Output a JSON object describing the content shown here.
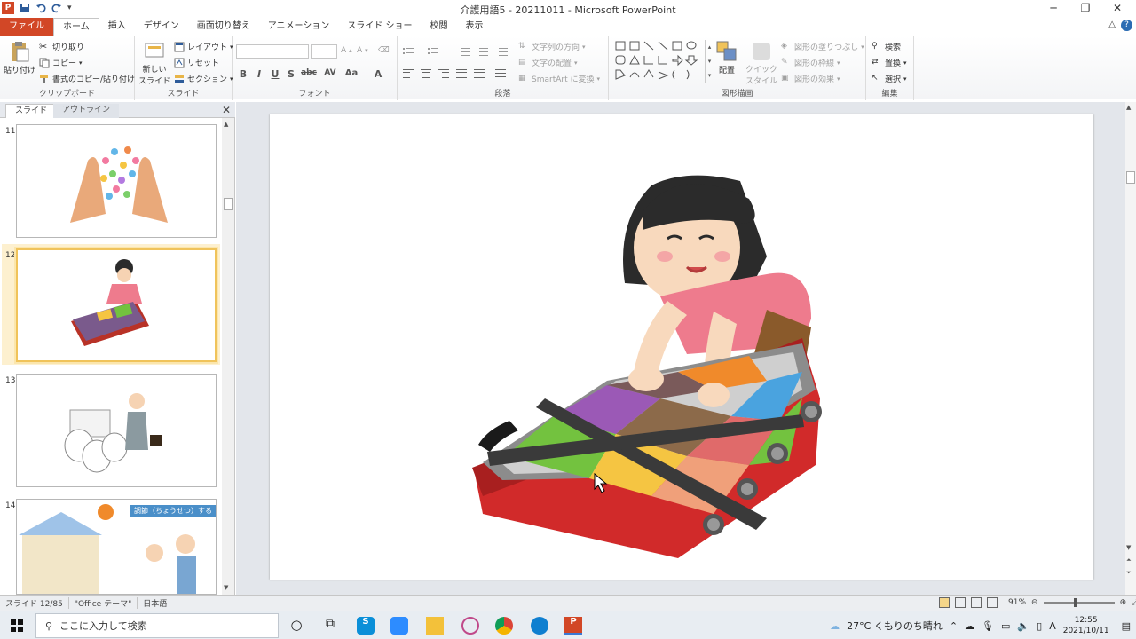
{
  "window": {
    "title": "介護用語5 - 20211011 - Microsoft PowerPoint",
    "minimize": "─",
    "restore": "❐",
    "close": "✕"
  },
  "qat": {
    "icons": [
      "save-icon",
      "undo-icon",
      "redo-icon",
      "customize-icon"
    ]
  },
  "tabs": [
    {
      "label": "ファイル"
    },
    {
      "label": "ホーム"
    },
    {
      "label": "挿入"
    },
    {
      "label": "デザイン"
    },
    {
      "label": "画面切り替え"
    },
    {
      "label": "アニメーション"
    },
    {
      "label": "スライド ショー"
    },
    {
      "label": "校閲"
    },
    {
      "label": "表示"
    }
  ],
  "ribbon": {
    "clipboard": {
      "paste": "貼り付け",
      "cut": "切り取り",
      "copy": "コピー",
      "format_painter": "書式のコピー/貼り付け",
      "label": "クリップボード"
    },
    "slides": {
      "new_slide": "新しい",
      "new_slide2": "スライド",
      "layout": "レイアウト",
      "reset": "リセット",
      "section": "セクション",
      "label": "スライド"
    },
    "font": {
      "label": "フォント",
      "bold": "B",
      "italic": "I",
      "underline": "U",
      "shadow": "S",
      "strike": "abc",
      "spacing": "AV",
      "case": "Aa",
      "color": "A",
      "grow": "A",
      "shrink": "A"
    },
    "paragraph": {
      "text_direction": "文字列の方向",
      "align_text": "文字の配置",
      "smartart": "SmartArt に変換",
      "label": "段落"
    },
    "drawing": {
      "arrange": "配置",
      "quick_styles": "クイック",
      "quick_styles2": "スタイル",
      "shape_fill": "図形の塗りつぶし",
      "shape_outline": "図形の枠線",
      "shape_effects": "図形の効果",
      "label": "図形描画"
    },
    "editing": {
      "find": "検索",
      "replace": "置換",
      "select": "選択",
      "label": "編集"
    }
  },
  "panel": {
    "tab_slides": "スライド",
    "tab_outline": "アウトライン",
    "close": "✕",
    "thumbnails": [
      {
        "num": "11"
      },
      {
        "num": "12"
      },
      {
        "num": "13"
      },
      {
        "num": "14",
        "caption": "調節（ちょうせつ）する"
      }
    ]
  },
  "status": {
    "slide": "スライド 12/85",
    "theme": "\"Office テーマ\"",
    "language": "日本語",
    "zoom": "91%",
    "zoom_level": 0.91
  },
  "taskbar": {
    "search_placeholder": "ここに入力して検索",
    "weather": "27°C くもりのち晴れ",
    "ime": "A",
    "time": "12:55",
    "date": "2021/10/11"
  },
  "colors": {
    "file_tab": "#d24726",
    "selected_thumb": "#f0c35a",
    "canvas_bg": "#e3e6eb"
  }
}
